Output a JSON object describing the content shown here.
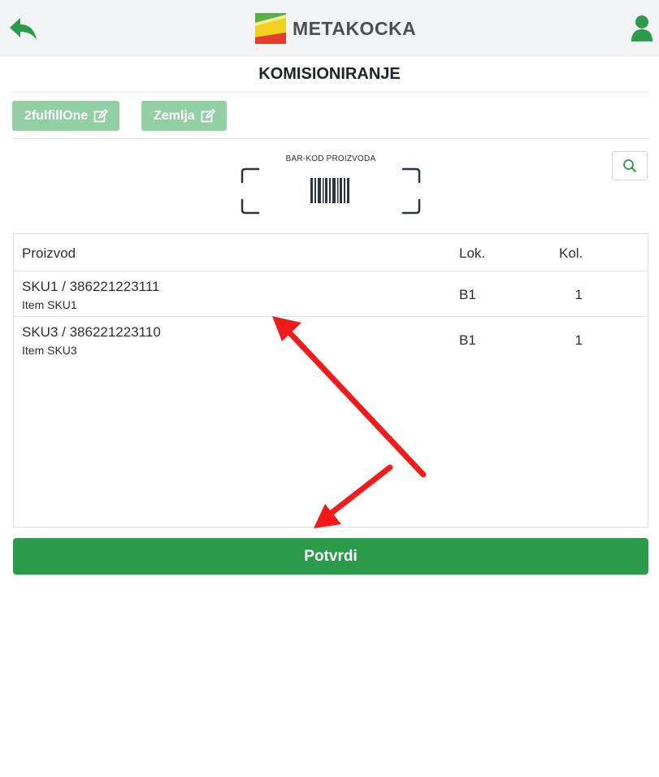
{
  "header": {
    "logo_text": "METAKOCKA",
    "back_icon": "back-arrow-icon",
    "user_icon": "user-icon",
    "colors": {
      "accent": "#2a9a4b",
      "logo_yellow": "#f0d21c",
      "logo_red": "#e53a2f",
      "logo_green": "#5ab04a"
    }
  },
  "page": {
    "title": "KOMISIONIRANJE"
  },
  "tags": [
    {
      "label": "2fulfillOne",
      "icon": "edit-icon"
    },
    {
      "label": "Zemlja",
      "icon": "edit-icon"
    }
  ],
  "scanner": {
    "caption": "BAR-KOD PROIZVODA",
    "icon": "barcode-scan-icon",
    "search_icon": "search-icon"
  },
  "table": {
    "columns": [
      "Proizvod",
      "Lok.",
      "Kol."
    ],
    "rows": [
      {
        "sku": "SKU1 / 386221223111",
        "name": "Item SKU1",
        "location": "B1",
        "quantity": "1"
      },
      {
        "sku": "SKU3 / 386221223110",
        "name": "Item SKU3",
        "location": "B1",
        "quantity": "1"
      }
    ]
  },
  "confirm": {
    "label": "Potvrdi"
  },
  "annotation_color": "#f01c1c"
}
